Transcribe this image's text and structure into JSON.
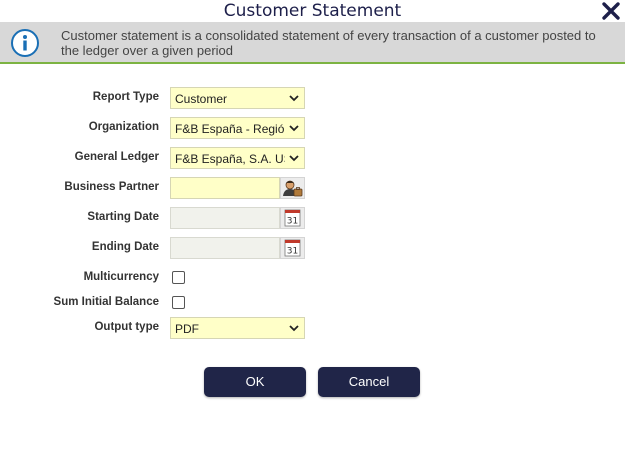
{
  "dialog": {
    "title": "Customer Statement",
    "info": "Customer statement is a consolidated statement of every transaction of a customer posted to the ledger over a given period"
  },
  "fields": {
    "report_type": {
      "label": "Report Type",
      "value": "Customer"
    },
    "organization": {
      "label": "Organization",
      "value": "F&B España - Región Norte"
    },
    "general_ledger": {
      "label": "General Ledger",
      "value": "F&B España, S.A. US/A/Euro"
    },
    "business_partner": {
      "label": "Business Partner",
      "value": ""
    },
    "starting_date": {
      "label": "Starting Date",
      "value": ""
    },
    "ending_date": {
      "label": "Ending Date",
      "value": ""
    },
    "multicurrency": {
      "label": "Multicurrency",
      "checked": false
    },
    "sum_initial_balance": {
      "label": "Sum Initial Balance",
      "checked": false
    },
    "output_type": {
      "label": "Output type",
      "value": "PDF"
    }
  },
  "buttons": {
    "ok": "OK",
    "cancel": "Cancel"
  },
  "calendar_day": "31",
  "colors": {
    "title_text": "#1d1f4a",
    "info_bar": "#d8d8d8",
    "info_border": "#7cb342",
    "required_field": "#ffffc8",
    "readonly_field": "#f1f2ec",
    "button": "#202548"
  }
}
